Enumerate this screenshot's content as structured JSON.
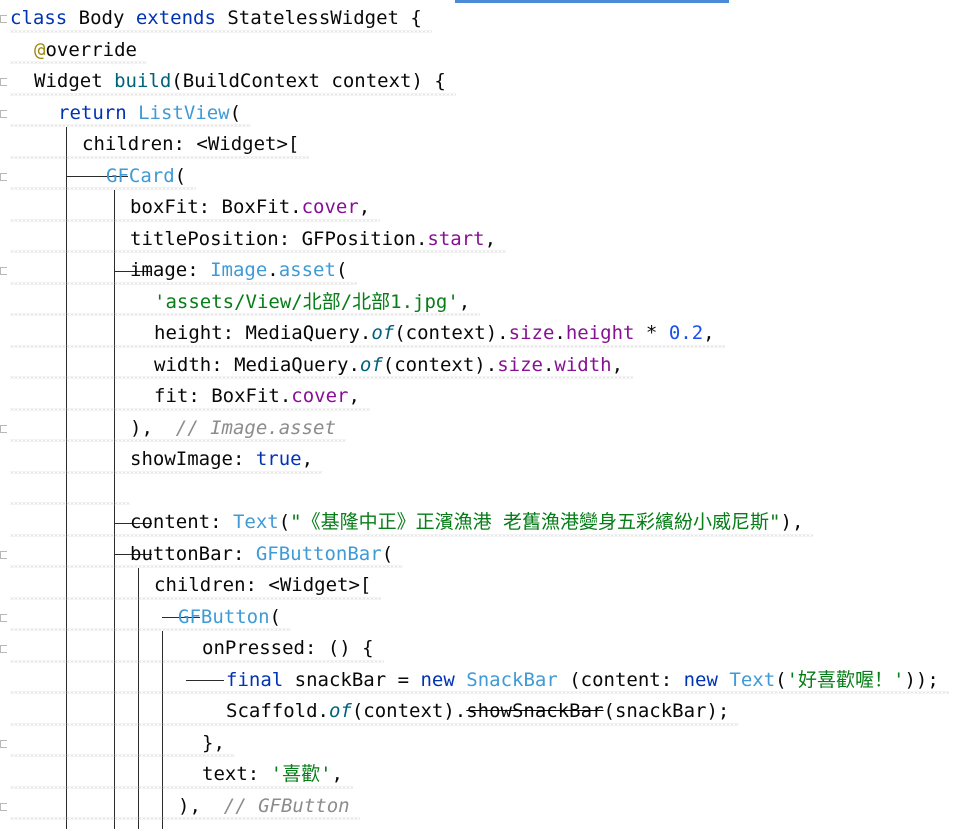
{
  "editor": {
    "language": "dart",
    "accent_color": "#4a8ad6",
    "lines": [
      {
        "tokens": [
          {
            "t": "class ",
            "c": "kw"
          },
          {
            "t": "Body ",
            "c": ""
          },
          {
            "t": "extends ",
            "c": "kw"
          },
          {
            "t": "StatelessWidget {",
            "c": ""
          }
        ],
        "fold": true
      },
      {
        "tokens": [
          {
            "t": "@",
            "c": "ann"
          },
          {
            "t": "override",
            "c": ""
          }
        ],
        "indent": 1
      },
      {
        "tokens": [
          {
            "t": "Widget ",
            "c": ""
          },
          {
            "t": "build",
            "c": "fn"
          },
          {
            "t": "(BuildContext context) {",
            "c": ""
          }
        ],
        "indent": 1,
        "fold": true
      },
      {
        "tokens": [
          {
            "t": "return ",
            "c": "kw"
          },
          {
            "t": "ListView",
            "c": "cls"
          },
          {
            "t": "(",
            "c": ""
          }
        ],
        "indent": 2,
        "fold": true
      },
      {
        "tokens": [
          {
            "t": "children: <Widget>[",
            "c": ""
          }
        ],
        "indent": 3
      },
      {
        "tokens": [
          {
            "t": "GFCard",
            "c": "cls"
          },
          {
            "t": "(",
            "c": ""
          }
        ],
        "indent": 4,
        "fold": true
      },
      {
        "tokens": [
          {
            "t": "boxFit: BoxFit.",
            "c": ""
          },
          {
            "t": "cover",
            "c": "fld"
          },
          {
            "t": ",",
            "c": ""
          }
        ],
        "indent": 5
      },
      {
        "tokens": [
          {
            "t": "titlePosition: GFPosition.",
            "c": ""
          },
          {
            "t": "start",
            "c": "fld"
          },
          {
            "t": ",",
            "c": ""
          }
        ],
        "indent": 5
      },
      {
        "tokens": [
          {
            "t": "image: ",
            "c": ""
          },
          {
            "t": "Image",
            "c": "cls"
          },
          {
            "t": ".",
            "c": ""
          },
          {
            "t": "asset",
            "c": "cls"
          },
          {
            "t": "(",
            "c": ""
          }
        ],
        "indent": 5,
        "fold": true
      },
      {
        "tokens": [
          {
            "t": "'assets/View/北部/北部1.jpg'",
            "c": "str"
          },
          {
            "t": ",",
            "c": ""
          }
        ],
        "indent": 6
      },
      {
        "tokens": [
          {
            "t": "height: MediaQuery.",
            "c": ""
          },
          {
            "t": "of",
            "c": "fn it"
          },
          {
            "t": "(context).",
            "c": ""
          },
          {
            "t": "size",
            "c": "fld"
          },
          {
            "t": ".",
            "c": ""
          },
          {
            "t": "height",
            "c": "fld"
          },
          {
            "t": " * ",
            "c": ""
          },
          {
            "t": "0.2",
            "c": "num"
          },
          {
            "t": ",",
            "c": ""
          }
        ],
        "indent": 6
      },
      {
        "tokens": [
          {
            "t": "width: MediaQuery.",
            "c": ""
          },
          {
            "t": "of",
            "c": "fn it"
          },
          {
            "t": "(context).",
            "c": ""
          },
          {
            "t": "size",
            "c": "fld"
          },
          {
            "t": ".",
            "c": ""
          },
          {
            "t": "width",
            "c": "fld"
          },
          {
            "t": ",",
            "c": ""
          }
        ],
        "indent": 6
      },
      {
        "tokens": [
          {
            "t": "fit: BoxFit.",
            "c": ""
          },
          {
            "t": "cover",
            "c": "fld"
          },
          {
            "t": ",",
            "c": ""
          }
        ],
        "indent": 6
      },
      {
        "tokens": [
          {
            "t": "),  ",
            "c": ""
          },
          {
            "t": "// Image.asset",
            "c": "cmt"
          }
        ],
        "indent": 5,
        "fold": true
      },
      {
        "tokens": [
          {
            "t": "showImage: ",
            "c": ""
          },
          {
            "t": "true",
            "c": "kw"
          },
          {
            "t": ",",
            "c": ""
          }
        ],
        "indent": 5
      },
      {
        "tokens": [],
        "indent": 5
      },
      {
        "tokens": [
          {
            "t": "content: ",
            "c": ""
          },
          {
            "t": "Text",
            "c": "cls"
          },
          {
            "t": "(",
            "c": ""
          },
          {
            "t": "\"《基隆中正》正濱漁港 老舊漁港變身五彩繽紛小威尼斯\"",
            "c": "str"
          },
          {
            "t": "),",
            "c": ""
          }
        ],
        "indent": 5
      },
      {
        "tokens": [
          {
            "t": "buttonBar: ",
            "c": ""
          },
          {
            "t": "GFButtonBar",
            "c": "cls"
          },
          {
            "t": "(",
            "c": ""
          }
        ],
        "indent": 5,
        "fold": true
      },
      {
        "tokens": [
          {
            "t": "children: <Widget>[",
            "c": ""
          }
        ],
        "indent": 6
      },
      {
        "tokens": [
          {
            "t": "GFButton",
            "c": "cls"
          },
          {
            "t": "(",
            "c": ""
          }
        ],
        "indent": 7,
        "fold": true
      },
      {
        "tokens": [
          {
            "t": "onPressed: () {",
            "c": ""
          }
        ],
        "indent": 8,
        "fold": true
      },
      {
        "tokens": [
          {
            "t": "final ",
            "c": "kw"
          },
          {
            "t": "snackBar = ",
            "c": ""
          },
          {
            "t": "new ",
            "c": "kw"
          },
          {
            "t": "SnackBar",
            "c": "cls"
          },
          {
            "t": " (content: ",
            "c": ""
          },
          {
            "t": "new ",
            "c": "kw"
          },
          {
            "t": "Text",
            "c": "cls"
          },
          {
            "t": "(",
            "c": ""
          },
          {
            "t": "'好喜歡喔！'",
            "c": "str"
          },
          {
            "t": "));",
            "c": ""
          }
        ],
        "indent": 9
      },
      {
        "tokens": [
          {
            "t": "Scaffold.",
            "c": ""
          },
          {
            "t": "of",
            "c": "fn it"
          },
          {
            "t": "(context).",
            "c": ""
          },
          {
            "t": "showSnackBar",
            "c": "strike"
          },
          {
            "t": "(snackBar);",
            "c": ""
          }
        ],
        "indent": 9
      },
      {
        "tokens": [
          {
            "t": "},",
            "c": ""
          }
        ],
        "indent": 8,
        "fold": true
      },
      {
        "tokens": [
          {
            "t": "text: ",
            "c": ""
          },
          {
            "t": "'喜歡'",
            "c": "str"
          },
          {
            "t": ",",
            "c": ""
          }
        ],
        "indent": 8
      },
      {
        "tokens": [
          {
            "t": "),  ",
            "c": ""
          },
          {
            "t": "// GFButton",
            "c": "cmt"
          }
        ],
        "indent": 7,
        "fold": true
      }
    ]
  }
}
